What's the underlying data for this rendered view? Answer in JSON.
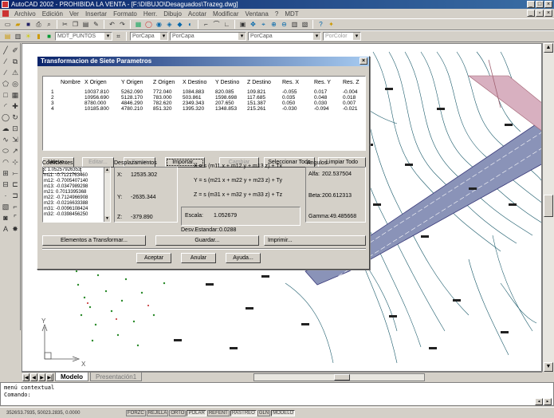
{
  "app": {
    "title": "AutoCAD 2002 - PROHIBIDA LA VENTA - [F:\\DIBUJO\\Desaguados\\Trazeg.dwg]",
    "menus": [
      "Archivo",
      "Edición",
      "Ver",
      "Insertar",
      "Formato",
      "Herr.",
      "Dibujo",
      "Acotar",
      "Modificar",
      "Ventana",
      "?",
      "MDT"
    ]
  },
  "toolbar2": {
    "layer_combo": "MDT_PUNTOS",
    "color_combo": "PorCapa",
    "linetype_combo": "PorCapa",
    "lineweight_combo": "PorCapa",
    "plotstyle_combo": "PorColor"
  },
  "dialog": {
    "title": "Transformacion de Siete Parametros",
    "close": "×",
    "columns": [
      "Nombre",
      "X Origen",
      "Y Origen",
      "Z Origen",
      "X Destino",
      "Y Destino",
      "Z Destino",
      "Res. X",
      "Res. Y",
      "Res. Z"
    ],
    "rows": [
      {
        "nombre": "1",
        "xo": "10037.810",
        "yo": "5262.090",
        "zo": "772.040",
        "xd": "1084.883",
        "yd": "820.085",
        "zd": "109.821",
        "rx": "-0.055",
        "ry": "0.017",
        "rz": "-0.004"
      },
      {
        "nombre": "2",
        "xo": "10956.690",
        "yo": "5128.170",
        "zo": "783.000",
        "xd": "503.861",
        "yd": "1598.698",
        "zd": "117.685",
        "rx": "0.035",
        "ry": "0.048",
        "rz": "0.018"
      },
      {
        "nombre": "3",
        "xo": "8780.000",
        "yo": "4846.290",
        "zo": "782.620",
        "xd": "2349.343",
        "yd": "207.650",
        "zd": "151.387",
        "rx": "0.050",
        "ry": "0.030",
        "rz": "0.007"
      },
      {
        "nombre": "4",
        "xo": "10185.800",
        "yo": "4780.210",
        "zo": "851.320",
        "xd": "1395.320",
        "yd": "1348.853",
        "zd": "215.261",
        "rx": "-0.030",
        "ry": "-0.094",
        "rz": "-0.021"
      }
    ],
    "buttons": {
      "nuevo": "Nuevo...",
      "editar": "Editar...",
      "borrar": "Borrar",
      "importar": "Importar...",
      "cambiar": "Cambiar",
      "seleccionar_todo": "Seleccionar Todo",
      "limpiar_todo": "Limpiar Todo",
      "elementos": "Elementos a Transformar...",
      "guardar": "Guardar...",
      "imprimir": "Imprimir...",
      "aceptar": "Aceptar",
      "anular": "Anular",
      "ayuda": "Ayuda..."
    },
    "coeficientes": {
      "label": "Coeficientes",
      "items": [
        "c 1.05257926353",
        "m11: -0.7121763460",
        "m12: -0.7005407140",
        "m13: -0.0347989298",
        "m21: 0.7013395368",
        "m22: -0.7124966908",
        "m23: -0.0216633388",
        "m31: -0.0096108424",
        "m32: -0.0398456250"
      ]
    },
    "desplazamientos": {
      "label": "Desplazamientos",
      "x_label": "X:",
      "x_value": "12535.302",
      "y_label": "Y:",
      "y_value": "-2635.344",
      "z_label": "Z:",
      "z_value": "-379.890"
    },
    "formulas": {
      "x": "X = s (m11 x + m12 y + m13 z) + Tx",
      "y": "Y = s (m21 x + m22 y + m23 z) + Ty",
      "z": "Z = s (m31 x + m32 y + m33 z) + Tz"
    },
    "escala_label": "Escala:",
    "escala_value": "1.052679",
    "desv_label": "Desv.Estandar:",
    "desv_value": "0.0288",
    "angulos": {
      "label": "Angulos:",
      "alfa_label": "Alfa:",
      "alfa_value": "202.537504",
      "beta_label": "Beta:",
      "beta_value": "200.612313",
      "gamma_label": "Gamma:",
      "gamma_value": "49.485668"
    }
  },
  "tabs": {
    "model": "Modelo",
    "layout": "Presentación1"
  },
  "ucs": {
    "y": "Y",
    "x": "X"
  },
  "command": {
    "line1": "menú contextual",
    "line2": "Comando:"
  },
  "status": {
    "coords": "3526S3.7935, 50023.2835, 0.0000",
    "buttons": [
      "FORZC",
      "REJILLA",
      "ORTO",
      "POLAR",
      "REFENT",
      "RASTREO",
      "GLN",
      "MODELO"
    ],
    "pressed": [
      "POLAR",
      "RASTREO",
      "MODELO"
    ]
  },
  "colors": {
    "title_bar": "#0a246a",
    "road_fill": "#8a93b8",
    "contour": "#1a5a6a",
    "highlight": "#d8b0c0"
  }
}
